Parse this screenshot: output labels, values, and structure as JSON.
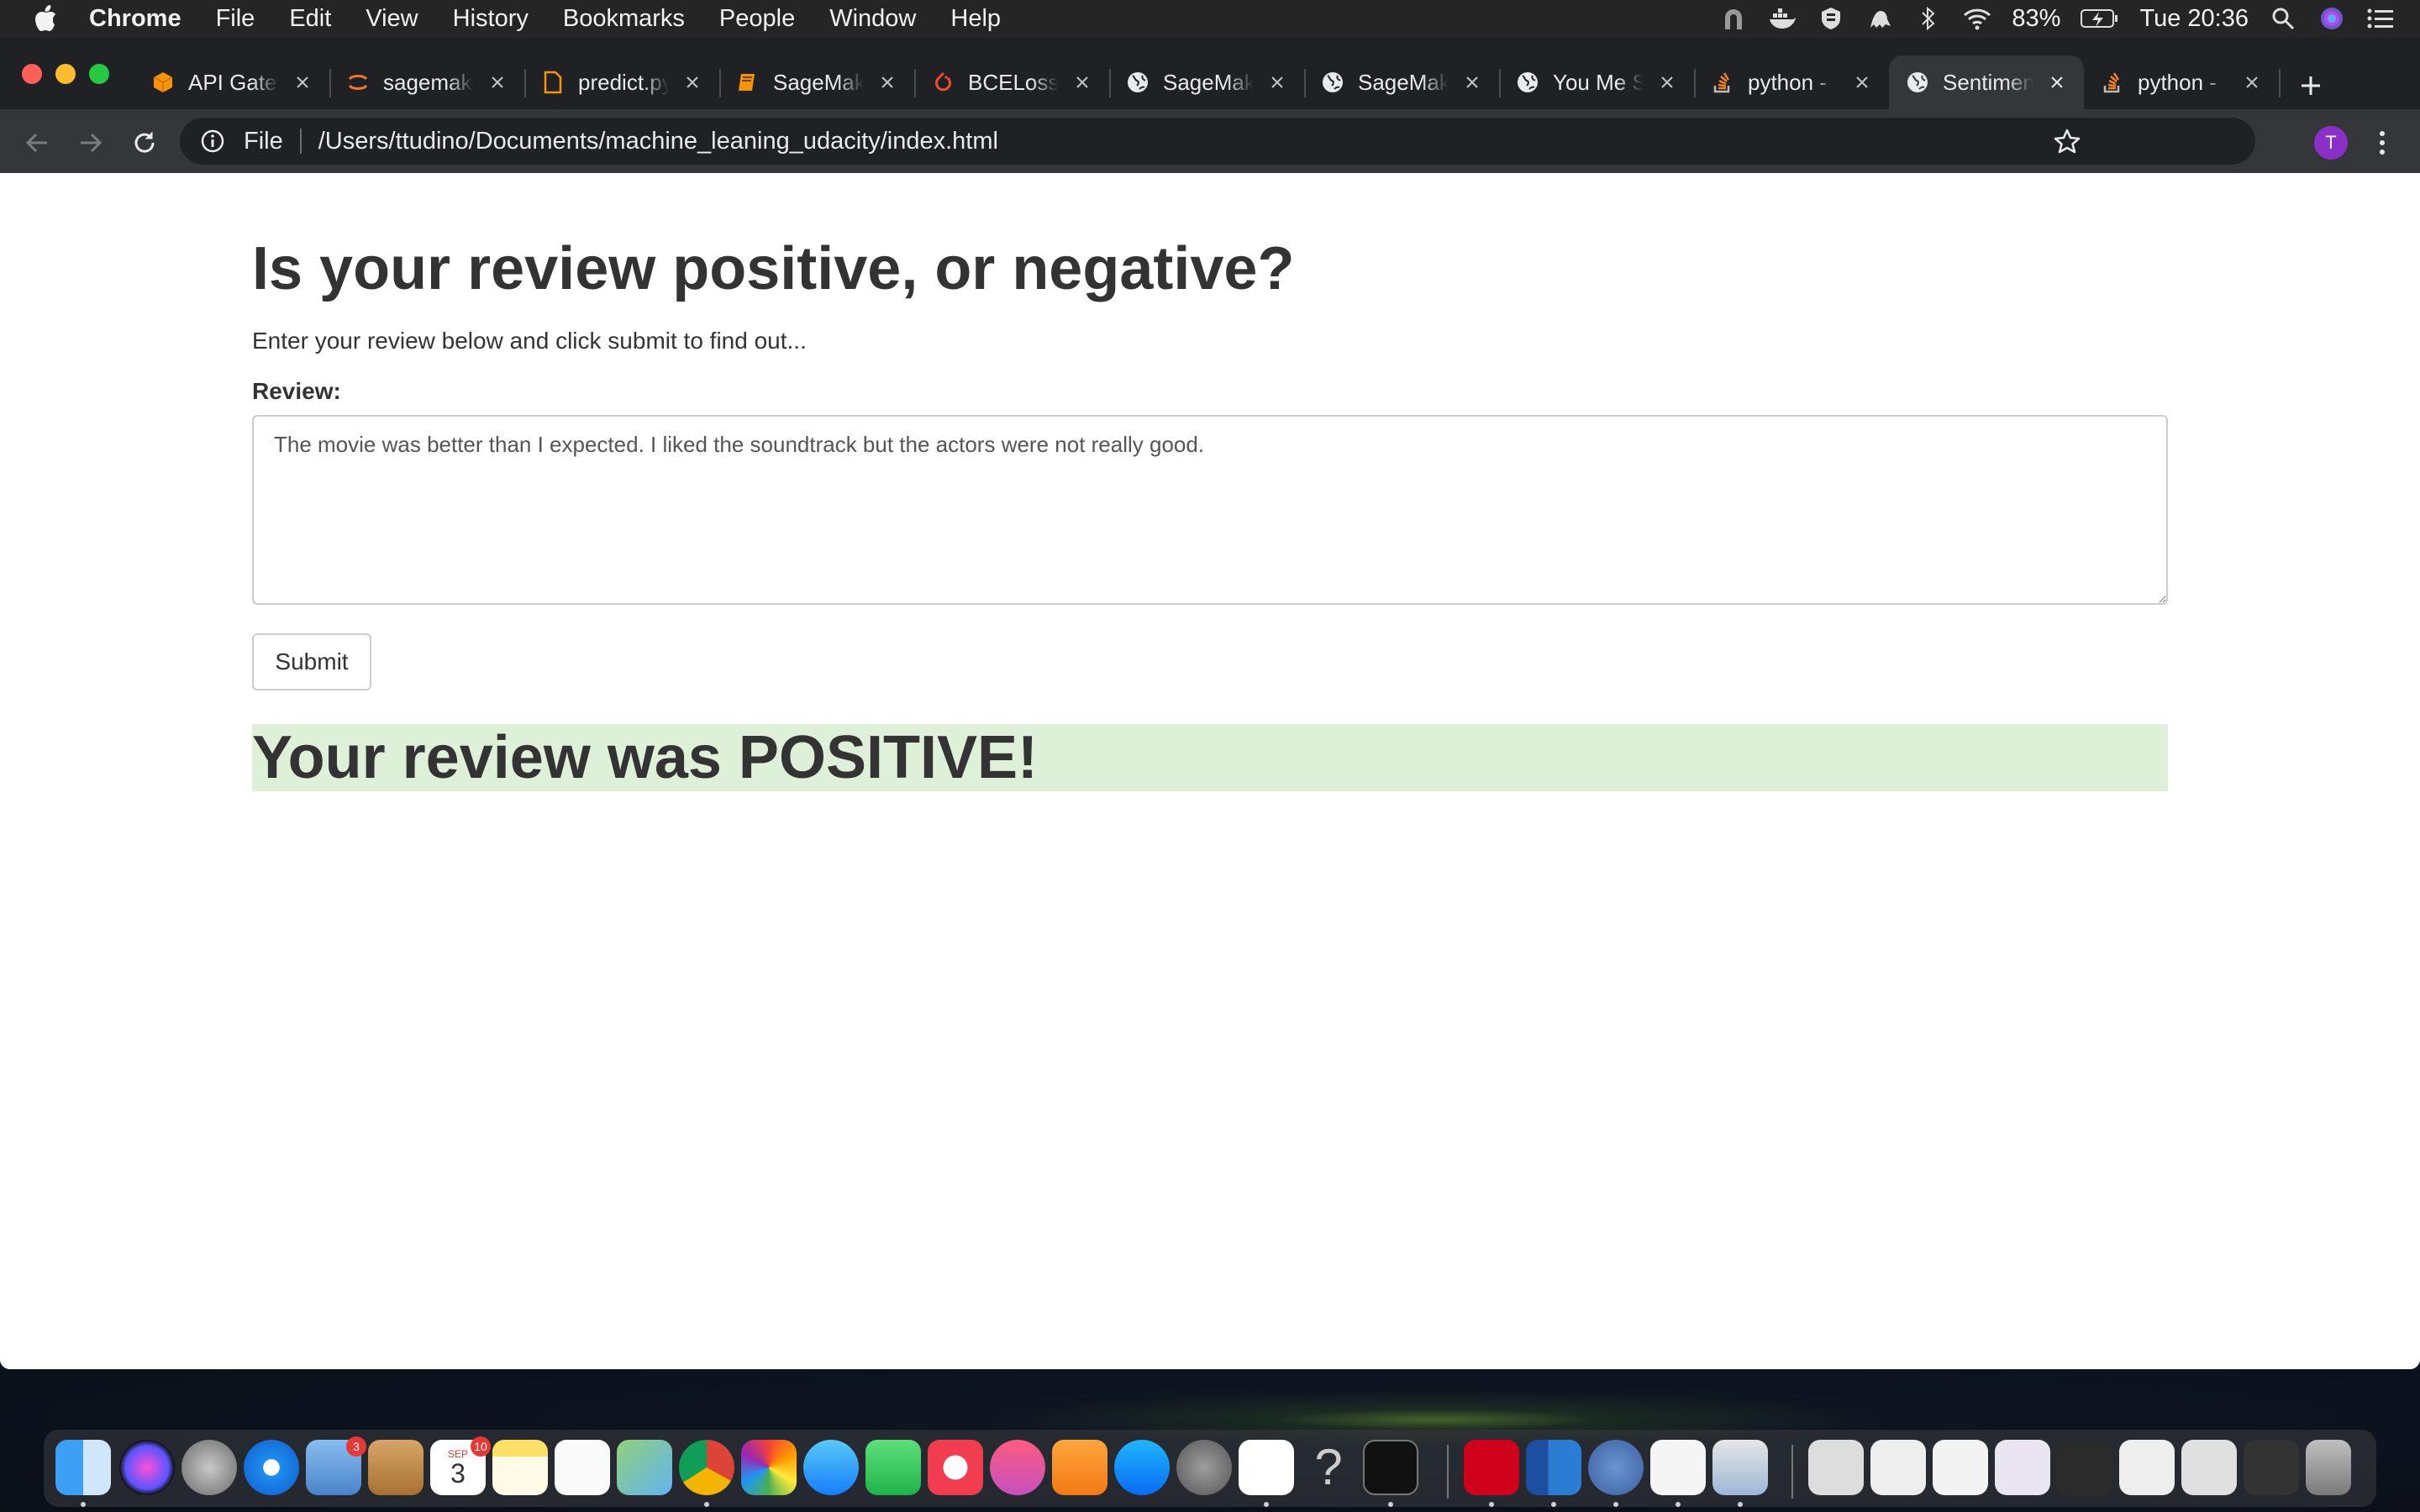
{
  "menubar": {
    "app_name": "Chrome",
    "items": [
      "File",
      "Edit",
      "View",
      "History",
      "Bookmarks",
      "People",
      "Window",
      "Help"
    ],
    "battery": "83%",
    "clock": "Tue 20:36"
  },
  "tabs": [
    {
      "title": "API Gateway",
      "icon": "aws-icon"
    },
    {
      "title": "sagemaker",
      "icon": "jupyter-icon"
    },
    {
      "title": "predict.py",
      "icon": "file-icon"
    },
    {
      "title": "SageMaker",
      "icon": "book-icon"
    },
    {
      "title": "BCELoss",
      "icon": "pytorch-icon"
    },
    {
      "title": "SageMaker",
      "icon": "globe-icon"
    },
    {
      "title": "SageMaker",
      "icon": "globe-icon"
    },
    {
      "title": "You Me S",
      "icon": "globe-icon"
    },
    {
      "title": "python -",
      "icon": "stackoverflow-icon"
    },
    {
      "title": "Sentiment",
      "icon": "globe-icon",
      "active": true
    },
    {
      "title": "python -",
      "icon": "stackoverflow-icon"
    }
  ],
  "omnibox": {
    "scheme": "File",
    "url": "/Users/ttudino/Documents/machine_leaning_udacity/index.html"
  },
  "profile_initial": "T",
  "page": {
    "heading": "Is your review positive, or negative?",
    "lead": "Enter your review below and click submit to find out...",
    "review_label": "Review:",
    "review_value": "The movie was better than I expected. I liked the soundtrack but the actors were not really good.",
    "submit_label": "Submit",
    "result": "Your review was POSITIVE!"
  },
  "dock": {
    "mail_badge": "3",
    "calendar_month": "SEP",
    "calendar_day": "3",
    "calendar_badge": "10"
  },
  "colors": {
    "result_bg": "#dff0d8",
    "tab_strip": "#202124",
    "toolbar": "#35363a",
    "avatar": "#8b2fc9"
  }
}
